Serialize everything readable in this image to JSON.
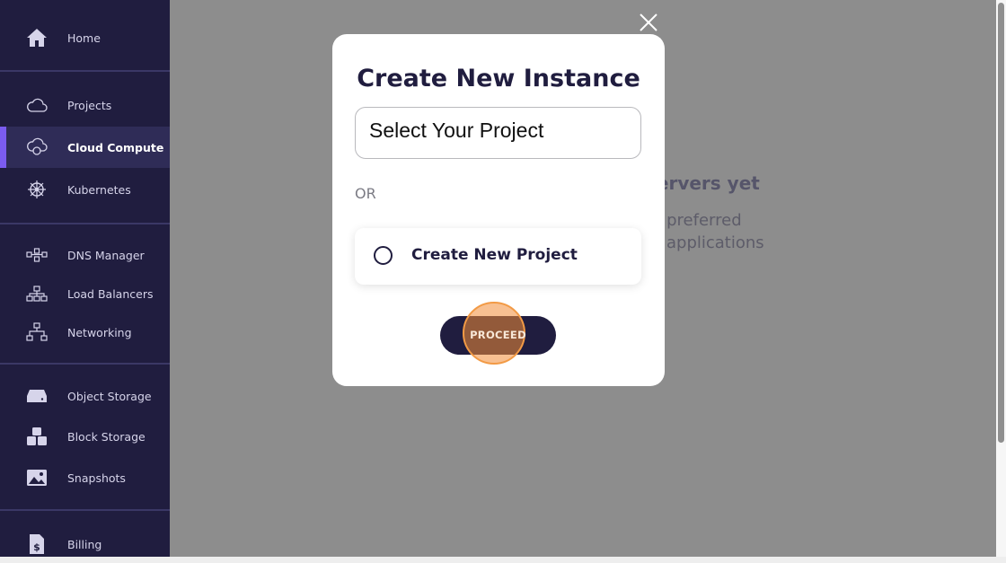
{
  "sidebar": {
    "items": [
      {
        "label": "Home",
        "icon": "home-icon"
      },
      {
        "label": "Projects",
        "icon": "cloud-icon"
      },
      {
        "label": "Cloud Compute",
        "icon": "cloud-compute-icon",
        "active": true
      },
      {
        "label": "Kubernetes",
        "icon": "kubernetes-icon"
      },
      {
        "label": "DNS Manager",
        "icon": "dns-icon"
      },
      {
        "label": "Load Balancers",
        "icon": "load-balancer-icon"
      },
      {
        "label": "Networking",
        "icon": "network-icon"
      },
      {
        "label": "Object Storage",
        "icon": "object-storage-icon"
      },
      {
        "label": "Block Storage",
        "icon": "block-storage-icon"
      },
      {
        "label": "Snapshots",
        "icon": "image-icon"
      },
      {
        "label": "Billing",
        "icon": "billing-icon"
      }
    ],
    "accent_color": "#7b5cf0",
    "background_color": "#201d3f"
  },
  "background": {
    "title_fragment": "servers yet",
    "line1_fragment": "r preferred",
    "line2_fragment": "applications"
  },
  "modal": {
    "title": "Create New Instance",
    "select_value": "Select Your Project",
    "or_text": "OR",
    "option_label": "Create New Project",
    "proceed_label": "PROCEED",
    "highlight_color": "#f29a45"
  }
}
